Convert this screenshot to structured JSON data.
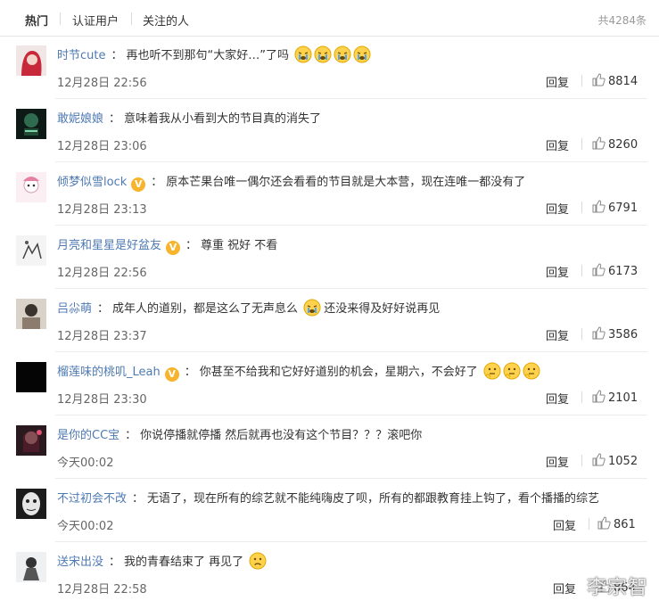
{
  "tabs": {
    "hot": "热门",
    "verified": "认证用户",
    "following": "关注的人",
    "total": "共4284条"
  },
  "reply_label": "回复",
  "watermark": "李宗智",
  "colors": {
    "username": "#4e7ab3",
    "badge": "#f7b42c",
    "divider": "#ececec"
  },
  "icons": {
    "like": "thumbs-up-icon",
    "badge": "verified-v-icon"
  },
  "comments": [
    {
      "user": "时节cute",
      "badge": false,
      "text": "再也听不到那句“大家好…”了吗",
      "emojis": [
        "crying-face",
        "crying-face",
        "crying-face",
        "crying-face"
      ],
      "text_after": "",
      "time": "12月28日 22:56",
      "likes": "8814"
    },
    {
      "user": "敢妮娘娘",
      "badge": false,
      "text": "意味着我从小看到大的节目真的消失了",
      "emojis": [],
      "text_after": "",
      "time": "12月28日 23:06",
      "likes": "8260"
    },
    {
      "user": "倾梦似雪lock",
      "badge": true,
      "text": "原本芒果台唯一偶尔还会看看的节目就是大本营，现在连唯一都没有了",
      "emojis": [],
      "text_after": "",
      "time": "12月28日 23:13",
      "likes": "6791"
    },
    {
      "user": "月亮和星星是好盆友",
      "badge": true,
      "text": "尊重 祝好 不看",
      "emojis": [],
      "text_after": "",
      "time": "12月28日 22:56",
      "likes": "6173"
    },
    {
      "user": "吕尛萌",
      "badge": false,
      "text": "成年人的道别，都是这么了无声息么",
      "emojis": [
        "crying-face"
      ],
      "text_after": "还没来得及好好说再见",
      "time": "12月28日 23:37",
      "likes": "3586"
    },
    {
      "user": "榴莲味的桃叽_Leah",
      "badge": true,
      "text": "你甚至不给我和它好好道别的机会，星期六，不会好了",
      "emojis": [
        "thinking-face",
        "thinking-face",
        "thinking-face"
      ],
      "text_after": "",
      "time": "12月28日 23:30",
      "likes": "2101"
    },
    {
      "user": "是你的CC宝",
      "badge": false,
      "text": "你说停播就停播 然后就再也没有这个节目？？？滚吧你",
      "emojis": [],
      "text_after": "",
      "time": "今天00:02",
      "likes": "1052"
    },
    {
      "user": "不过初会不改",
      "badge": false,
      "text": "无语了，现在所有的综艺就不能纯嗨皮了呗，所有的都跟教育挂上钩了，看个播播的综艺",
      "emojis": [],
      "text_after": "",
      "time": "今天00:02",
      "likes": "861"
    },
    {
      "user": "送宋出没",
      "badge": false,
      "text": "我的青春结束了 再见了",
      "emojis": [
        "sad-face"
      ],
      "text_after": "",
      "time": "12月28日 22:58",
      "likes": "864"
    }
  ]
}
